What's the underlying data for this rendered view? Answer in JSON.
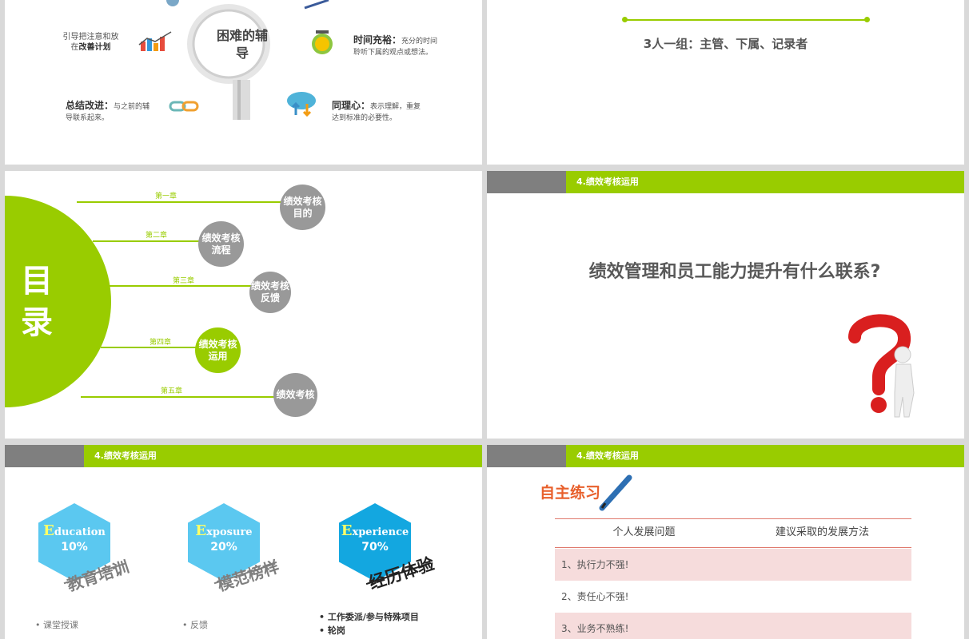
{
  "slide1": {
    "center_title": "困难的辅导",
    "item_guide": {
      "text": "引导把注意和放",
      "text2": "在",
      "emph": "改善计划"
    },
    "item_time": {
      "title": "时间充裕：",
      "desc": "充分的时间聆听下属的观点或想法。"
    },
    "item_summary": {
      "title": "总结改进：",
      "desc": "与之前的辅导联系起来。"
    },
    "item_empathy": {
      "title": "同理心：",
      "desc": "表示理解，重复达到标准的必要性。"
    }
  },
  "slide2": {
    "text": "3人一组：主管、下属、记录者"
  },
  "slide3": {
    "big_title": "目录",
    "chapters": [
      {
        "label": "第一章",
        "circle": "绩效考核目的"
      },
      {
        "label": "第二章",
        "circle": "绩效考核流程"
      },
      {
        "label": "第三章",
        "circle": "绩效考核反馈"
      },
      {
        "label": "第四章",
        "circle": "绩效考核运用"
      },
      {
        "label": "第五章",
        "circle": "绩效考核"
      }
    ]
  },
  "slide4": {
    "header": "4.绩效考核运用",
    "question": "绩效管理和员工能力提升有什么联系?"
  },
  "slide5": {
    "header": "4.绩效考核运用",
    "hexes": [
      {
        "word": "ducation",
        "initial": "E",
        "pct": "10%",
        "tag": "教育培训",
        "color": "#5bc8f0"
      },
      {
        "word": "xposure",
        "initial": "E",
        "pct": "20%",
        "tag": "模范榜样",
        "color": "#5bc8f0"
      },
      {
        "word": "xperience",
        "initial": "E",
        "pct": "70%",
        "tag": "经历体验",
        "color": "#13a7e0"
      }
    ],
    "bullets_1": [
      "课堂授课"
    ],
    "bullets_2": [
      "反馈"
    ],
    "bullets_3": [
      "工作委派/参与特殊项目",
      "轮岗"
    ]
  },
  "slide6": {
    "header": "4.绩效考核运用",
    "title": "自主练习",
    "col1": "个人发展问题",
    "col2": "建议采取的发展方法",
    "rows": [
      "1、执行力不强!",
      "2、责任心不强!",
      "3、业务不熟练!"
    ]
  },
  "colors": {
    "accent": "#99cc00",
    "gray": "#7f7f7f",
    "pink": "#f6dcdc"
  }
}
